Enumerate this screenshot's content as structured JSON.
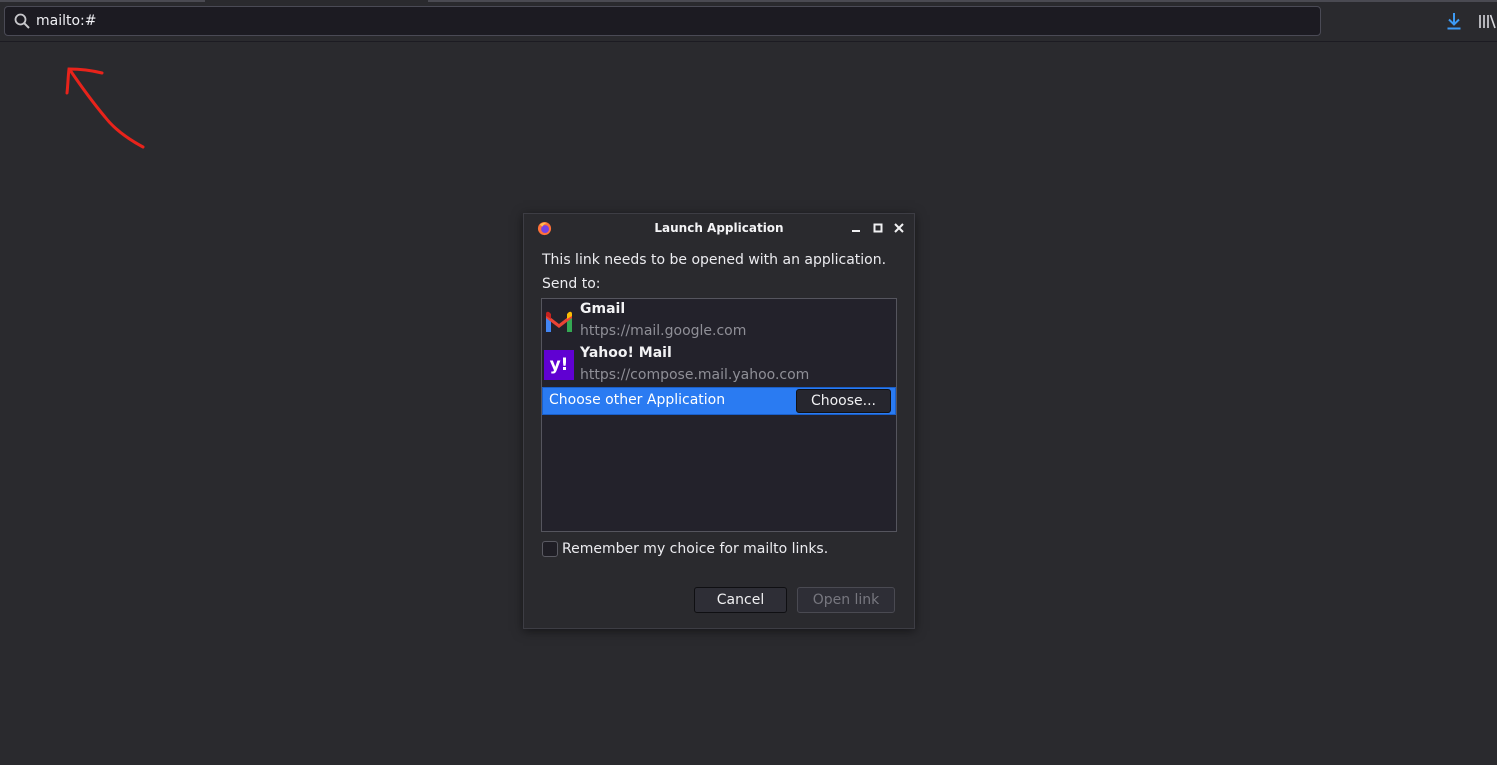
{
  "toolbar": {
    "url": "mailto:#",
    "icons": [
      "search-icon",
      "download-icon",
      "library-icon"
    ],
    "accent_color": "#3d9bf5"
  },
  "annotation": {
    "color": "#e8231b",
    "shape": "arrow pointing to url bar"
  },
  "dialog": {
    "title": "Launch Application",
    "message": "This link needs to be opened with an application.",
    "send_to_label": "Send to:",
    "apps": [
      {
        "name": "Gmail",
        "url": "https://mail.google.com",
        "icon": "gmail-icon"
      },
      {
        "name": "Yahoo! Mail",
        "url": "https://compose.mail.yahoo.com",
        "icon": "yahoo-mail-icon",
        "logo_text": "y!"
      }
    ],
    "choose_other_label": "Choose other Application",
    "choose_button": "Choose...",
    "remember_label": "Remember my choice for mailto links.",
    "cancel_button": "Cancel",
    "open_button": "Open link",
    "selection_color": "#2a7bf2"
  }
}
